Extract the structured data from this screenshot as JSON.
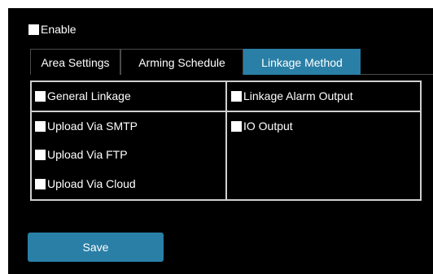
{
  "enable": {
    "label": "Enable",
    "checked": false
  },
  "tabs": [
    {
      "label": "Area Settings",
      "active": false
    },
    {
      "label": "Arming Schedule",
      "active": false
    },
    {
      "label": "Linkage Method",
      "active": true
    }
  ],
  "linkage": {
    "left_header": {
      "label": "General Linkage",
      "checked": false
    },
    "right_header": {
      "label": "Linkage Alarm Output",
      "checked": false
    },
    "left_options": [
      {
        "label": "Upload Via SMTP",
        "checked": false
      },
      {
        "label": "Upload Via FTP",
        "checked": false
      },
      {
        "label": "Upload Via Cloud",
        "checked": false
      }
    ],
    "right_options": [
      {
        "label": "IO Output",
        "checked": false
      }
    ]
  },
  "save_label": "Save",
  "colors": {
    "background": "#000000",
    "accent": "#2a7fa6",
    "border": "#cfcfcf",
    "text": "#ffffff"
  }
}
